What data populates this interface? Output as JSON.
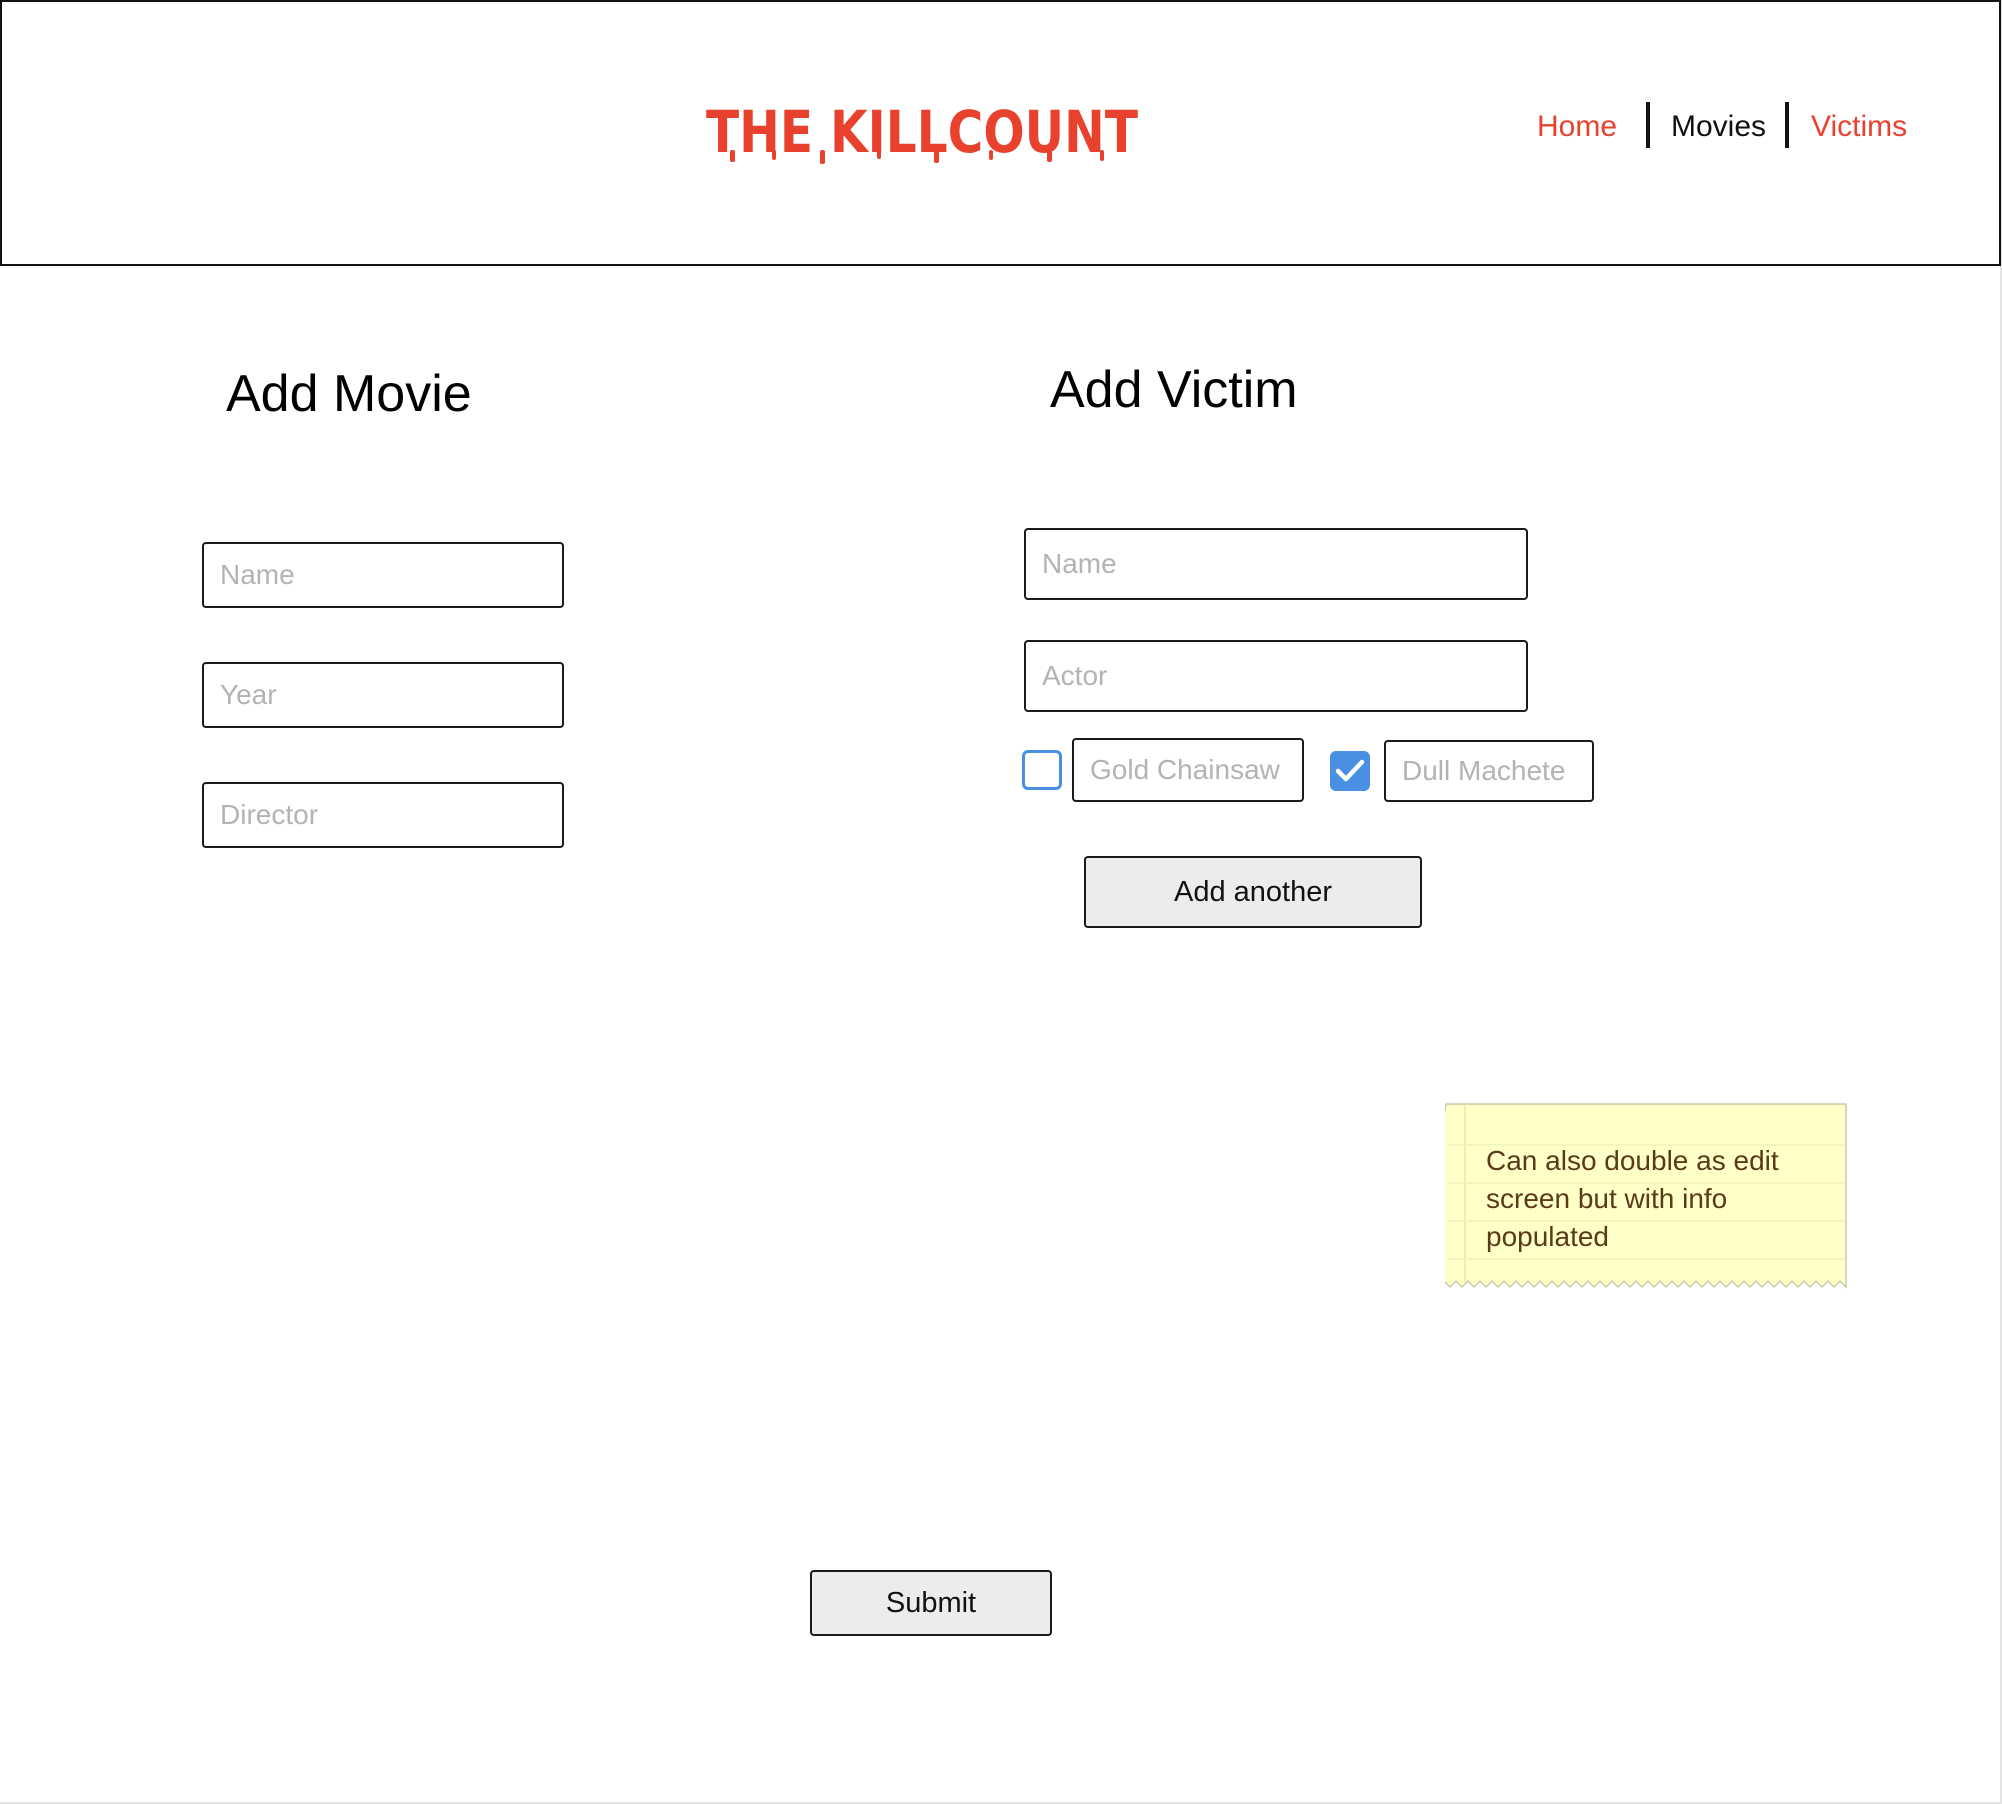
{
  "header": {
    "logo_text": "THE KILLCOUNT",
    "nav": [
      {
        "label": "Home",
        "color": "#e8422f"
      },
      {
        "label": "Movies",
        "color": "#111111"
      },
      {
        "label": "Victims",
        "color": "#e8422f"
      }
    ]
  },
  "movie_form": {
    "title": "Add Movie",
    "name_placeholder": "Name",
    "year_placeholder": "Year",
    "director_placeholder": "Director"
  },
  "victim_form": {
    "title": "Add Victim",
    "name_placeholder": "Name",
    "actor_placeholder": "Actor",
    "weapons": [
      {
        "placeholder": "Gold Chainsaw",
        "checked": false
      },
      {
        "placeholder": "Dull Machete",
        "checked": true
      }
    ],
    "add_another_label": "Add another"
  },
  "submit_label": "Submit",
  "sticky_note": {
    "text": "Can also double as edit screen but with info populated"
  },
  "colors": {
    "accent": "#e8422f",
    "checkbox_blue": "#4a90e2",
    "note_bg": "#ffffc8"
  }
}
